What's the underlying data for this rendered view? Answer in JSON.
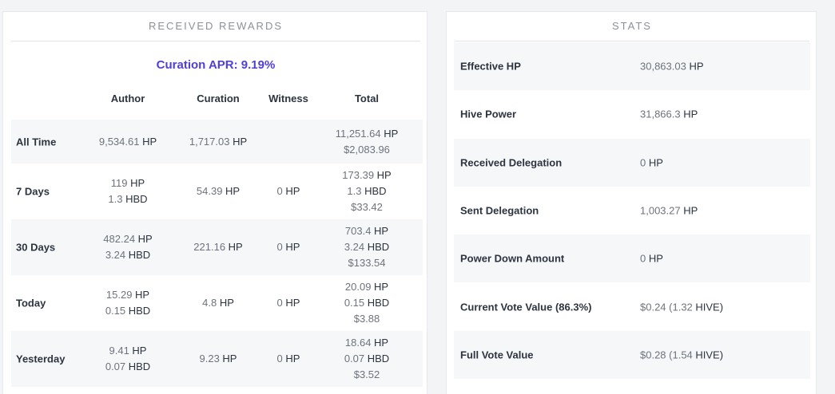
{
  "rewards": {
    "title": "RECEIVED REWARDS",
    "apr": "Curation APR: 9.19%",
    "columns": {
      "author": "Author",
      "curation": "Curation",
      "witness": "Witness",
      "total": "Total"
    },
    "rows": [
      {
        "label": "All Time",
        "author": [
          {
            "n": "9,534.61",
            "u": "HP"
          }
        ],
        "curation": [
          {
            "n": "1,717.03",
            "u": "HP"
          }
        ],
        "witness": [],
        "total": [
          {
            "n": "11,251.64",
            "u": "HP"
          },
          {
            "n": "$2,083.96",
            "u": ""
          }
        ]
      },
      {
        "label": "7 Days",
        "author": [
          {
            "n": "119",
            "u": "HP"
          },
          {
            "n": "1.3",
            "u": "HBD"
          }
        ],
        "curation": [
          {
            "n": "54.39",
            "u": "HP"
          }
        ],
        "witness": [
          {
            "n": "0",
            "u": "HP"
          }
        ],
        "total": [
          {
            "n": "173.39",
            "u": "HP"
          },
          {
            "n": "1.3",
            "u": "HBD"
          },
          {
            "n": "$33.42",
            "u": ""
          }
        ]
      },
      {
        "label": "30 Days",
        "author": [
          {
            "n": "482.24",
            "u": "HP"
          },
          {
            "n": "3.24",
            "u": "HBD"
          }
        ],
        "curation": [
          {
            "n": "221.16",
            "u": "HP"
          }
        ],
        "witness": [
          {
            "n": "0",
            "u": "HP"
          }
        ],
        "total": [
          {
            "n": "703.4",
            "u": "HP"
          },
          {
            "n": "3.24",
            "u": "HBD"
          },
          {
            "n": "$133.54",
            "u": ""
          }
        ]
      },
      {
        "label": "Today",
        "author": [
          {
            "n": "15.29",
            "u": "HP"
          },
          {
            "n": "0.15",
            "u": "HBD"
          }
        ],
        "curation": [
          {
            "n": "4.8",
            "u": "HP"
          }
        ],
        "witness": [
          {
            "n": "0",
            "u": "HP"
          }
        ],
        "total": [
          {
            "n": "20.09",
            "u": "HP"
          },
          {
            "n": "0.15",
            "u": "HBD"
          },
          {
            "n": "$3.88",
            "u": ""
          }
        ]
      },
      {
        "label": "Yesterday",
        "author": [
          {
            "n": "9.41",
            "u": "HP"
          },
          {
            "n": "0.07",
            "u": "HBD"
          }
        ],
        "curation": [
          {
            "n": "9.23",
            "u": "HP"
          }
        ],
        "witness": [
          {
            "n": "0",
            "u": "HP"
          }
        ],
        "total": [
          {
            "n": "18.64",
            "u": "HP"
          },
          {
            "n": "0.07",
            "u": "HBD"
          },
          {
            "n": "$3.52",
            "u": ""
          }
        ]
      }
    ]
  },
  "stats": {
    "title": "STATS",
    "rows": [
      {
        "label": "Effective HP",
        "n": "30,863.03",
        "u": "HP"
      },
      {
        "label": "Hive Power",
        "n": "31,866.3",
        "u": "HP"
      },
      {
        "label": "Received Delegation",
        "n": "0",
        "u": "HP"
      },
      {
        "label": "Sent Delegation",
        "n": "1,003.27",
        "u": "HP"
      },
      {
        "label": "Power Down Amount",
        "n": "0",
        "u": "HP"
      },
      {
        "label": "Current Vote Value (86.3%)",
        "n": "$0.24 (1.32",
        "u": "HIVE)"
      },
      {
        "label": "Full Vote Value",
        "n": "$0.28 (1.54",
        "u": "HIVE)"
      }
    ]
  },
  "colors": {
    "accent": "#4e3fd8",
    "row_shade": "#f6f7f9",
    "muted_text": "#6d737c",
    "strong_text": "#2c3440"
  }
}
